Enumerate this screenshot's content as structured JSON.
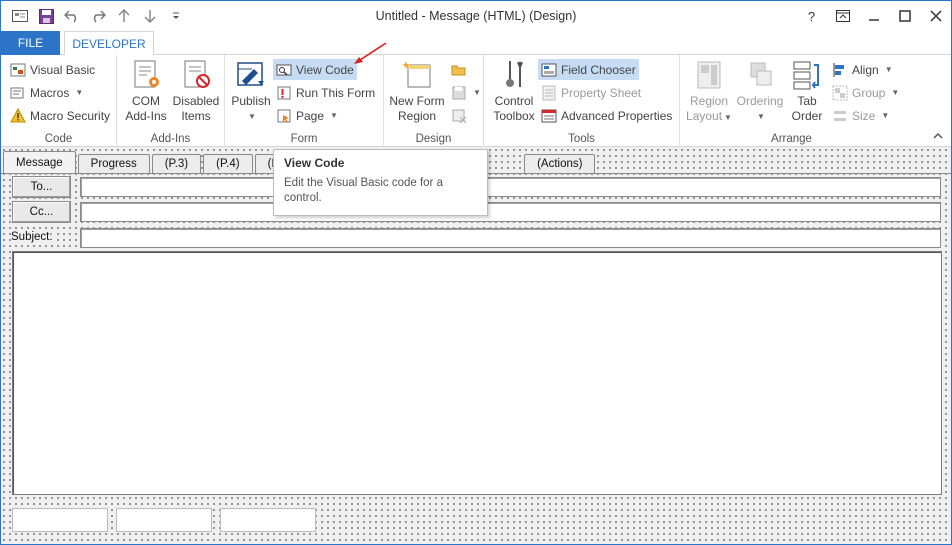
{
  "window": {
    "title": "Untitled - Message (HTML)  (Design)",
    "controls": [
      "?",
      "restore-ribbon",
      "minimize",
      "maximize",
      "close"
    ]
  },
  "qat": {
    "items": [
      "mail-icon",
      "save-icon",
      "undo-icon",
      "redo-icon",
      "up-arrow-icon",
      "down-arrow-icon",
      "customize-icon"
    ]
  },
  "tabs": {
    "file": "FILE",
    "developer": "DEVELOPER"
  },
  "ribbon": {
    "code": {
      "label": "Code",
      "visual_basic": "Visual Basic",
      "macros": "Macros",
      "macro_security": "Macro Security"
    },
    "addins": {
      "label": "Add-Ins",
      "com_addins_1": "COM",
      "com_addins_2": "Add-Ins",
      "disabled_items_1": "Disabled",
      "disabled_items_2": "Items"
    },
    "form": {
      "label": "Form",
      "publish": "Publish",
      "view_code": "View Code",
      "run_this_form": "Run This Form",
      "page": "Page"
    },
    "design": {
      "label": "Design",
      "new_form_region_1": "New Form",
      "new_form_region_2": "Region"
    },
    "tools": {
      "label": "Tools",
      "control_toolbox_1": "Control",
      "control_toolbox_2": "Toolbox",
      "field_chooser": "Field Chooser",
      "property_sheet": "Property Sheet",
      "advanced_properties": "Advanced Properties"
    },
    "arrange": {
      "label": "Arrange",
      "region_layout_1": "Region",
      "region_layout_2": "Layout",
      "ordering": "Ordering",
      "tab_order_1": "Tab",
      "tab_order_2": "Order",
      "align": "Align",
      "group": "Group",
      "size": "Size"
    }
  },
  "tooltip": {
    "title": "View Code",
    "description": "Edit the Visual Basic code for a control."
  },
  "form_tabs": [
    "Message",
    "Progress",
    "(P.3)",
    "(P.4)",
    "(P.5)",
    "(Actions)"
  ],
  "form": {
    "to_button": "To...",
    "cc_button": "Cc...",
    "subject_label": "Subject:"
  },
  "colors": {
    "accent": "#2b74c7",
    "highlight": "#c5dcf4",
    "arrow": "#e0201c"
  }
}
